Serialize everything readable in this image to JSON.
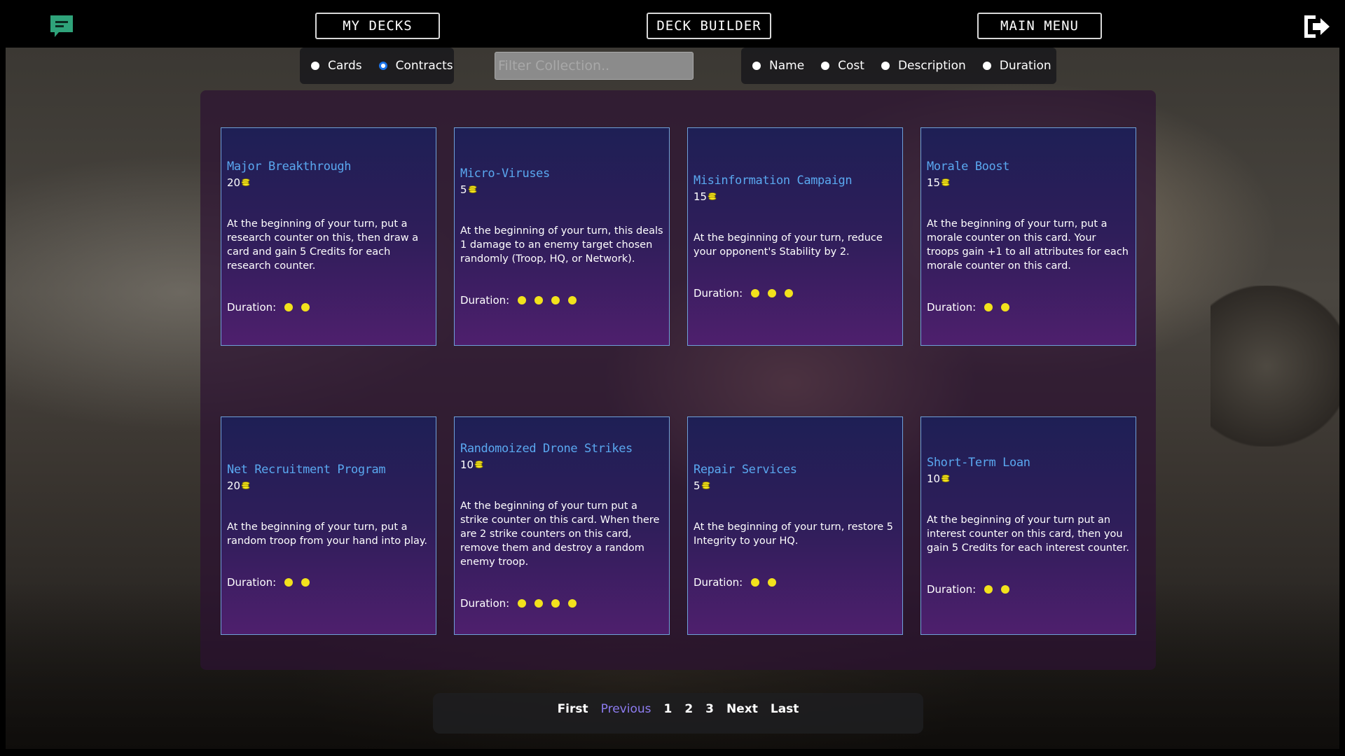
{
  "nav": {
    "my_decks": "MY DECKS",
    "deck_builder": "DECK BUILDER",
    "main_menu": "MAIN MENU"
  },
  "icons": {
    "chat": "chat-icon",
    "logout": "logout-icon",
    "coin": "coin-stack-icon"
  },
  "type_filter": {
    "options": [
      "Cards",
      "Contracts"
    ],
    "selected": "Contracts"
  },
  "search": {
    "placeholder": "Filter Collection..",
    "value": ""
  },
  "sort_filter": {
    "options": [
      "Name",
      "Cost",
      "Description",
      "Duration"
    ],
    "selected": null
  },
  "duration_label": "Duration:",
  "cards": [
    {
      "name": "Major Breakthrough",
      "cost": "20",
      "description": "At the beginning of your turn, put a research counter on this, then draw a card and gain 5 Credits for each research counter.",
      "duration": 2
    },
    {
      "name": "Micro-Viruses",
      "cost": "5",
      "description": "At the beginning of your turn, this deals 1 damage to an enemy target chosen randomly (Troop, HQ, or Network).",
      "duration": 4
    },
    {
      "name": "Misinformation Campaign",
      "cost": "15",
      "description": "At the beginning of your turn, reduce your opponent's Stability by 2.",
      "duration": 3
    },
    {
      "name": "Morale Boost",
      "cost": "15",
      "description": "At the beginning of your turn, put a morale counter on this card. Your troops gain +1 to all attributes for each morale counter on this card.",
      "duration": 2
    },
    {
      "name": "Net Recruitment Program",
      "cost": "20",
      "description": "At the beginning of your turn, put a random troop from your hand into play.",
      "duration": 2
    },
    {
      "name": "Randomoized Drone Strikes",
      "cost": "10",
      "description": "At the beginning of your turn put a strike counter on this card. When there are 2 strike counters on this card, remove them and destroy a random enemy troop.",
      "duration": 4
    },
    {
      "name": "Repair Services",
      "cost": "5",
      "description": "At the beginning of your turn, restore 5 Integrity to your HQ.",
      "duration": 2
    },
    {
      "name": "Short-Term Loan",
      "cost": "10",
      "description": "At the beginning of your turn put an interest counter on this card, then you gain 5 Credits for each interest counter.",
      "duration": 2
    }
  ],
  "pagination": {
    "first": "First",
    "previous": "Previous",
    "pages": [
      "1",
      "2",
      "3"
    ],
    "next": "Next",
    "last": "Last",
    "active": "Previous"
  },
  "colors": {
    "card_title": "#5aa8f0",
    "duration_pip": "#f2e21c",
    "coin": "#f2e21c",
    "chat_icon": "#2fa37a",
    "pager_active": "#8d7cf0"
  }
}
